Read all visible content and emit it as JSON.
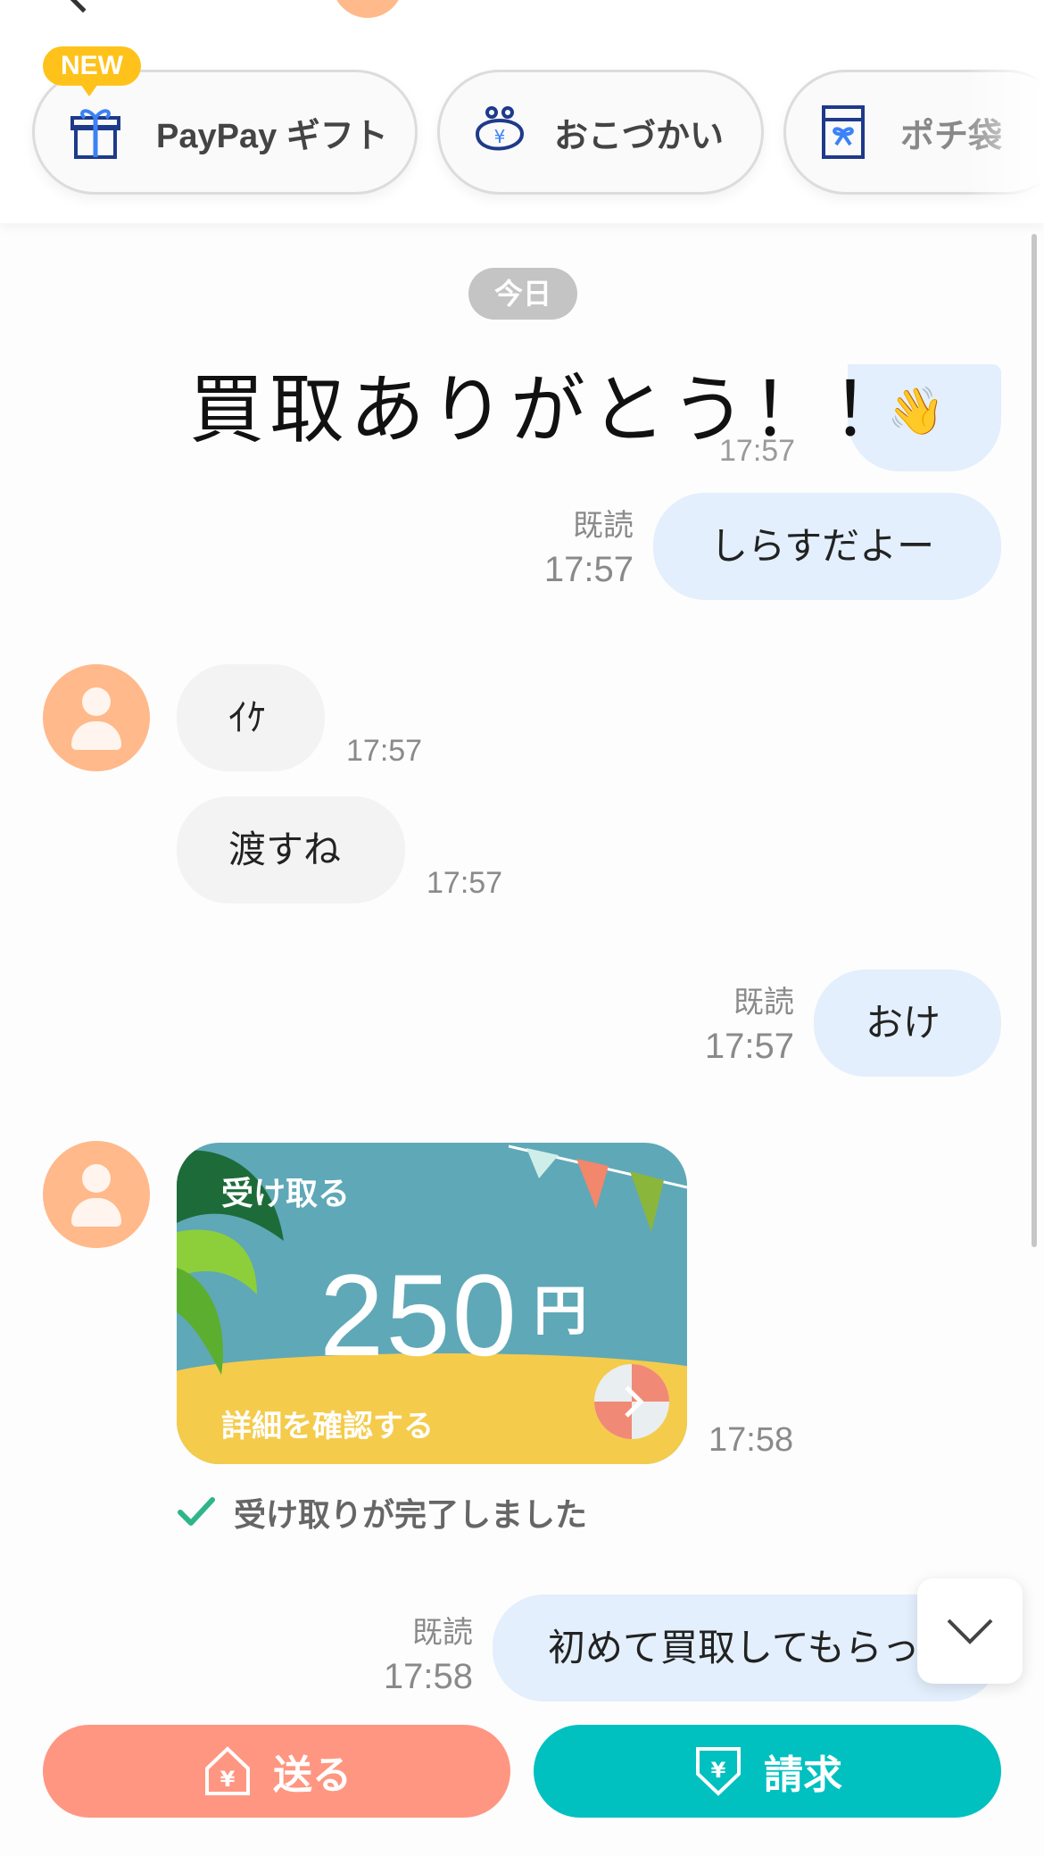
{
  "header": {
    "new_badge": "NEW",
    "chips": [
      "PayPay ギフト",
      "おこづかい",
      "ポチ袋"
    ]
  },
  "chat": {
    "date_label": "今日",
    "handwritten_overlay": "買取ありがとう！！",
    "messages": [
      {
        "dir": "out",
        "text": "しらすだよー",
        "read": "既読",
        "time": "17:57"
      },
      {
        "dir": "in",
        "text": "ｲｹ",
        "time": "17:57"
      },
      {
        "dir": "in",
        "text": "渡すね",
        "time": "17:57"
      },
      {
        "dir": "out",
        "text": "おけ",
        "read": "既読",
        "time": "17:57"
      },
      {
        "dir": "out",
        "text": "初めて買取してもらっ",
        "read": "既読",
        "time": "17:58"
      }
    ],
    "gift_card": {
      "title": "受け取る",
      "amount": "250",
      "unit": "円",
      "detail": "詳細を確認する",
      "time": "17:58",
      "status": "受け取りが完了しました"
    }
  },
  "actions": {
    "send_label": "送る",
    "request_label": "請求"
  },
  "colors": {
    "send": "#ff9682",
    "request": "#00c0c0",
    "outgoing_bubble": "#e3effc",
    "incoming_bubble": "#f3f3f3",
    "avatar": "#ffb98a",
    "new_badge": "#ffc21a"
  }
}
